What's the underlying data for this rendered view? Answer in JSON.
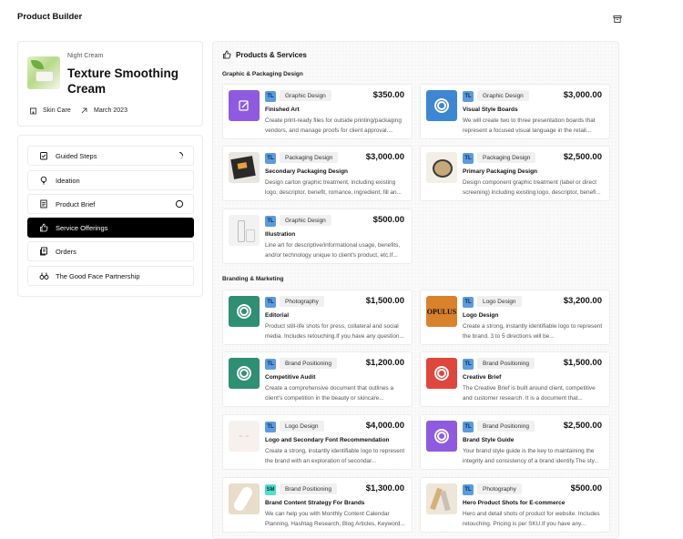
{
  "app": {
    "title": "Product Builder",
    "top_icon": "archive-icon"
  },
  "product": {
    "kicker": "Night Cream",
    "name": "Texture Smoothing Cream",
    "category": "Skin Care",
    "date": "March 2023"
  },
  "steps": [
    {
      "label": "Guided Steps",
      "icon": "checklist-icon",
      "status": "loading"
    },
    {
      "label": "Ideation",
      "icon": "lightbulb-icon",
      "status": ""
    },
    {
      "label": "Product Brief",
      "icon": "document-icon",
      "status": "empty-circle"
    },
    {
      "label": "Service Offerings",
      "icon": "thumbs-up-icon",
      "status": "",
      "active": true
    },
    {
      "label": "Orders",
      "icon": "orders-icon",
      "status": ""
    },
    {
      "label": "The Good Face Partnership",
      "icon": "partnership-icon",
      "status": ""
    }
  ],
  "main": {
    "title": "Products & Services",
    "sections": [
      "Graphic & Packaging Design",
      "Branding & Marketing"
    ]
  },
  "cards": [
    {
      "badge": "TL",
      "badge_color": "#5b9be0",
      "category": "Graphic Design",
      "price": "$350.00",
      "title": "Finished Art",
      "desc": "Create print-ready files for outside printing/packaging vendors, and manage proofs for client approval....",
      "thumb": "purple-edit",
      "thumb_color": "#8e5be0"
    },
    {
      "badge": "TL",
      "badge_color": "#5b9be0",
      "category": "Graphic Design",
      "price": "$3,000.00",
      "title": "Visual Style Boards",
      "desc": "We will create two to three presentation boards that represent a focused visual language in the retail...",
      "thumb": "blue-ring",
      "thumb_color": "#3d86d4"
    },
    {
      "badge": "TL",
      "badge_color": "#5b9be0",
      "category": "Packaging Design",
      "price": "$3,000.00",
      "title": "Secondary Packaging Design",
      "desc": "Design carton graphic treatment, including existing logo, descriptor, benefit, romance, ingredient, fill an...",
      "thumb": "box-photo",
      "thumb_color": "#2a2a2a"
    },
    {
      "badge": "TL",
      "badge_color": "#5b9be0",
      "category": "Packaging Design",
      "price": "$2,500.00",
      "title": "Primary Packaging Design",
      "desc": "Design component graphic treatment (label or direct screening) including existing logo, descriptor, benefi...",
      "thumb": "compact-photo",
      "thumb_color": "#c7a877"
    },
    {
      "badge": "TL",
      "badge_color": "#5b9be0",
      "category": "Graphic Design",
      "price": "$500.00",
      "title": "Illustration",
      "desc": "Line art for descriptive/informational usage, benefits, and/or technology unique to client's product, etc.If...",
      "thumb": "bottle-sketch",
      "thumb_color": "#f2f2f2"
    },
    {
      "badge": "TL",
      "badge_color": "#5b9be0",
      "category": "Photography",
      "price": "$1,500.00",
      "title": "Editorial",
      "desc": "Product still-life shots for press, collateral and social media. Includes retouching.If you have any question...",
      "thumb": "green-ring",
      "thumb_color": "#2f8f72"
    },
    {
      "badge": "TL",
      "badge_color": "#5b9be0",
      "category": "Logo Design",
      "price": "$3,200.00",
      "title": "Logo Design",
      "desc": "Create a strong, instantly identifiable logo to represent the brand. 3 to 5 directions will be...",
      "thumb": "opulus-logo",
      "thumb_color": "#d9822b",
      "thumb_text": "OPULUS"
    },
    {
      "badge": "TL",
      "badge_color": "#5b9be0",
      "category": "Brand Positioning",
      "price": "$1,200.00",
      "title": "Competitive Audit",
      "desc": "Create a comprehensive document that outlines a client's competition in the beauty or skincare...",
      "thumb": "green-ring",
      "thumb_color": "#2f8f72"
    },
    {
      "badge": "TL",
      "badge_color": "#5b9be0",
      "category": "Brand Positioning",
      "price": "$1,500.00",
      "title": "Creative Brief",
      "desc": "The Creative Brief is built around client, competitive and customer research. It is a document that...",
      "thumb": "red-ring",
      "thumb_color": "#e0463c"
    },
    {
      "badge": "TL",
      "badge_color": "#5b9be0",
      "category": "Logo Design",
      "price": "$4,000.00",
      "title": "Logo and Secondary Font Recommendation",
      "desc": "Create a strong, instantly identifiable logo to represent the brand with an exploration of secondar...",
      "thumb": "script-logo",
      "thumb_color": "#f7f1ee"
    },
    {
      "badge": "TL",
      "badge_color": "#5b9be0",
      "category": "Brand Positioning",
      "price": "$2,500.00",
      "title": "Brand Style Guide",
      "desc": "Your brand style guide is the key to maintaining the integrity and consistency of a brand identity.The sty...",
      "thumb": "purple-ring",
      "thumb_color": "#8e5be0"
    },
    {
      "badge": "SM",
      "badge_color": "#4fe0c6",
      "category": "Brand Positioning",
      "price": "$1,300.00",
      "title": "Brand Content Strategy For Brands",
      "desc": "We can help you with Monthly Content Calendar Planning, Hashtag Research, Blog Articles, Keyword...",
      "thumb": "hand-photo",
      "thumb_color": "#e8dccb"
    },
    {
      "badge": "TL",
      "badge_color": "#5b9be0",
      "category": "Photography",
      "price": "$500.00",
      "title": "Hero Product Shots for E-commerce",
      "desc": "Hero and detail shots of product for website. Includes retouching. Pricing is per SKU.If you have any...",
      "thumb": "products-photo",
      "thumb_color": "#efe6da"
    }
  ]
}
